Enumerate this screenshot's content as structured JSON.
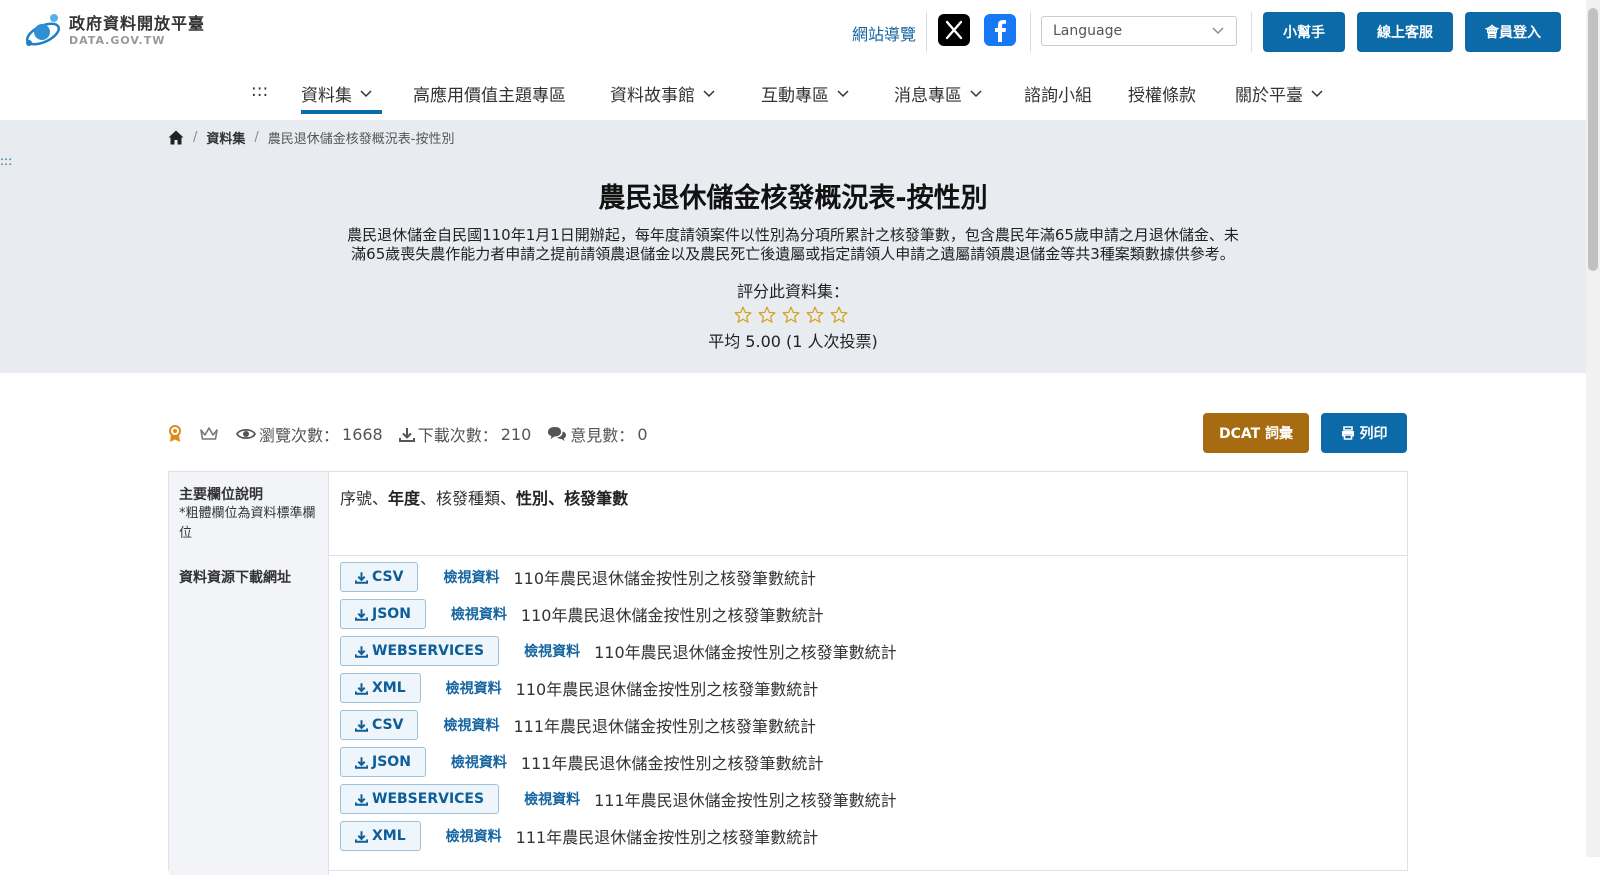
{
  "header": {
    "logo_zh": "政府資料開放平臺",
    "logo_en": "DATA.GOV.TW",
    "site_map": "網站導覽",
    "language_placeholder": "Language",
    "buttons": [
      "小幫手",
      "線上客服",
      "會員登入"
    ]
  },
  "nav": {
    "skip": ":::",
    "items": [
      "資料集",
      "高應用價值主題專區",
      "資料故事館",
      "互動專區",
      "消息專區",
      "諮詢小組",
      "授權條款",
      "關於平臺"
    ]
  },
  "breadcrumb": {
    "items": [
      "資料集",
      "農民退休儲金核發概況表-按性別"
    ],
    "separator": "/"
  },
  "skip_link": ":::",
  "dataset": {
    "title": "農民退休儲金核發概況表-按性別",
    "desc_line1": "農民退休儲金自民國110年1月1日開辦起，每年度請領案件以性別為分項所累計之核發筆數，包含農民年滿65歲申請之月退休儲金、未",
    "desc_line2": "滿65歲喪失農作能力者申請之提前請領農退儲金以及農民死亡後遺屬或指定請領人申請之遺屬請領農退儲金等共3種案類數據供參考。",
    "rate_label": "評分此資料集：",
    "rating_value": 0,
    "rating_max": 5,
    "avg": "平均 5.00 (1 人次投票)"
  },
  "stats": {
    "views_label": "瀏覽次數：",
    "views": "1668",
    "downloads_label": "下載次數：",
    "downloads": "210",
    "comments_label": "意見數：",
    "comments": "0",
    "dcat_label": "DCAT 詞彙",
    "print_label": "列印"
  },
  "table": {
    "fields_header": "主要欄位說明",
    "fields_note": "*粗體欄位為資料標準欄位",
    "fields": {
      "f1": "序號、",
      "f2": "年度",
      "f3": "、核發種類、",
      "f4": "性別",
      "f5": "、",
      "f6": "核發筆數"
    },
    "resources_header": "資料資源下載網址",
    "view_label": "檢視資料",
    "resources": [
      {
        "format": "CSV",
        "name": "110年農民退休儲金按性別之核發筆數統計"
      },
      {
        "format": "JSON",
        "name": "110年農民退休儲金按性別之核發筆數統計"
      },
      {
        "format": "WEBSERVICES",
        "name": "110年農民退休儲金按性別之核發筆數統計"
      },
      {
        "format": "XML",
        "name": "110年農民退休儲金按性別之核發筆數統計"
      },
      {
        "format": "CSV",
        "name": "111年農民退休儲金按性別之核發筆數統計"
      },
      {
        "format": "JSON",
        "name": "111年農民退休儲金按性別之核發筆數統計"
      },
      {
        "format": "WEBSERVICES",
        "name": "111年農民退休儲金按性別之核發筆數統計"
      },
      {
        "format": "XML",
        "name": "111年農民退休儲金按性別之核發筆數統計"
      }
    ]
  },
  "colors": {
    "primary": "#0d6aa8",
    "dcat": "#a76c12",
    "hero_bg": "#e8ecf1",
    "star": "#d4a017"
  }
}
